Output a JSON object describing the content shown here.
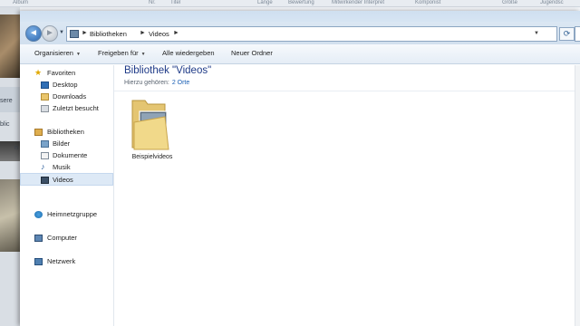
{
  "background_player": {
    "columns": [
      "Album",
      "",
      "Nr.",
      "Titel",
      "",
      "Länge",
      "Bewertung",
      "Mitwirkender Interpret",
      "Komponist",
      "Größe",
      "Jugendsc"
    ],
    "fragments": [
      "sere",
      "blic",
      "n"
    ]
  },
  "explorer": {
    "address": {
      "crumbs": [
        "Bibliotheken",
        "Videos"
      ],
      "separator": "►"
    },
    "toolbar": {
      "organize": "Organisieren",
      "share": "Freigeben für",
      "play_all": "Alle wiedergeben",
      "new_folder": "Neuer Ordner"
    },
    "sidebar": {
      "favorites": "Favoriten",
      "desktop": "Desktop",
      "downloads": "Downloads",
      "recent": "Zuletzt besucht",
      "libraries": "Bibliotheken",
      "pictures": "Bilder",
      "documents": "Dokumente",
      "music": "Musik",
      "videos": "Videos",
      "homegroup": "Heimnetzgruppe",
      "computer": "Computer",
      "network": "Netzwerk"
    },
    "main": {
      "title": "Bibliothek \"Videos\"",
      "includes_label": "Hierzu gehören:",
      "includes_link": "2 Orte",
      "items": [
        {
          "label": "Beispielvideos"
        }
      ]
    }
  },
  "colors": {
    "title_blue": "#1e3a87",
    "link_blue": "#1a5fb4",
    "selection": "#dde9f6"
  },
  "icons": [
    "back-arrow-icon",
    "forward-arrow-icon",
    "folder-icon",
    "refresh-icon",
    "star-icon",
    "library-icon",
    "homegroup-icon",
    "computer-icon",
    "network-icon"
  ]
}
